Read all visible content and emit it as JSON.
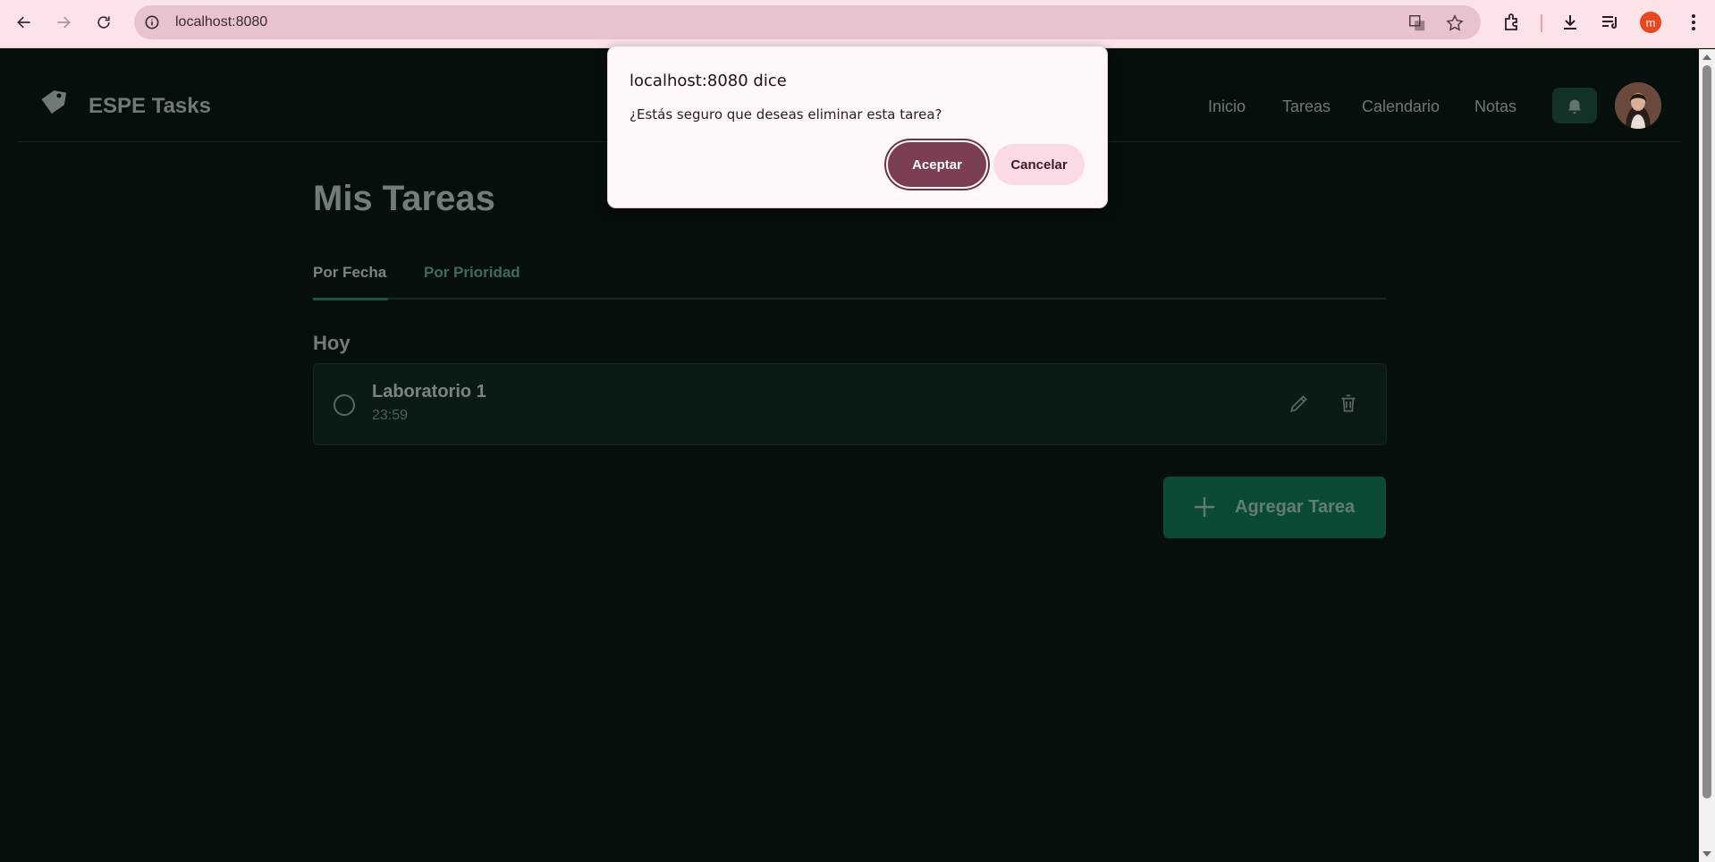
{
  "browser": {
    "url": "localhost:8080",
    "profile_initial": "m"
  },
  "header": {
    "brand": "ESPE Tasks",
    "nav": [
      "Inicio",
      "Tareas",
      "Calendario",
      "Notas"
    ]
  },
  "main": {
    "title": "Mis Tareas",
    "tabs": [
      {
        "label": "Por Fecha",
        "active": true
      },
      {
        "label": "Por Prioridad",
        "active": false
      }
    ],
    "sections": [
      {
        "title": "Hoy",
        "tasks": [
          {
            "title": "Laboratorio 1",
            "time": "23:59"
          }
        ]
      }
    ],
    "add_button_label": "Agregar Tarea"
  },
  "dialog": {
    "title": "localhost:8080 dice",
    "message": "¿Estás seguro que deseas eliminar esta tarea?",
    "accept_label": "Aceptar",
    "cancel_label": "Cancelar"
  },
  "colors": {
    "page_bg": "#060f0c",
    "accent_green": "#0b4a35",
    "dialog_accept": "#7b3f4f",
    "chrome_bg": "#fbe3e8"
  }
}
